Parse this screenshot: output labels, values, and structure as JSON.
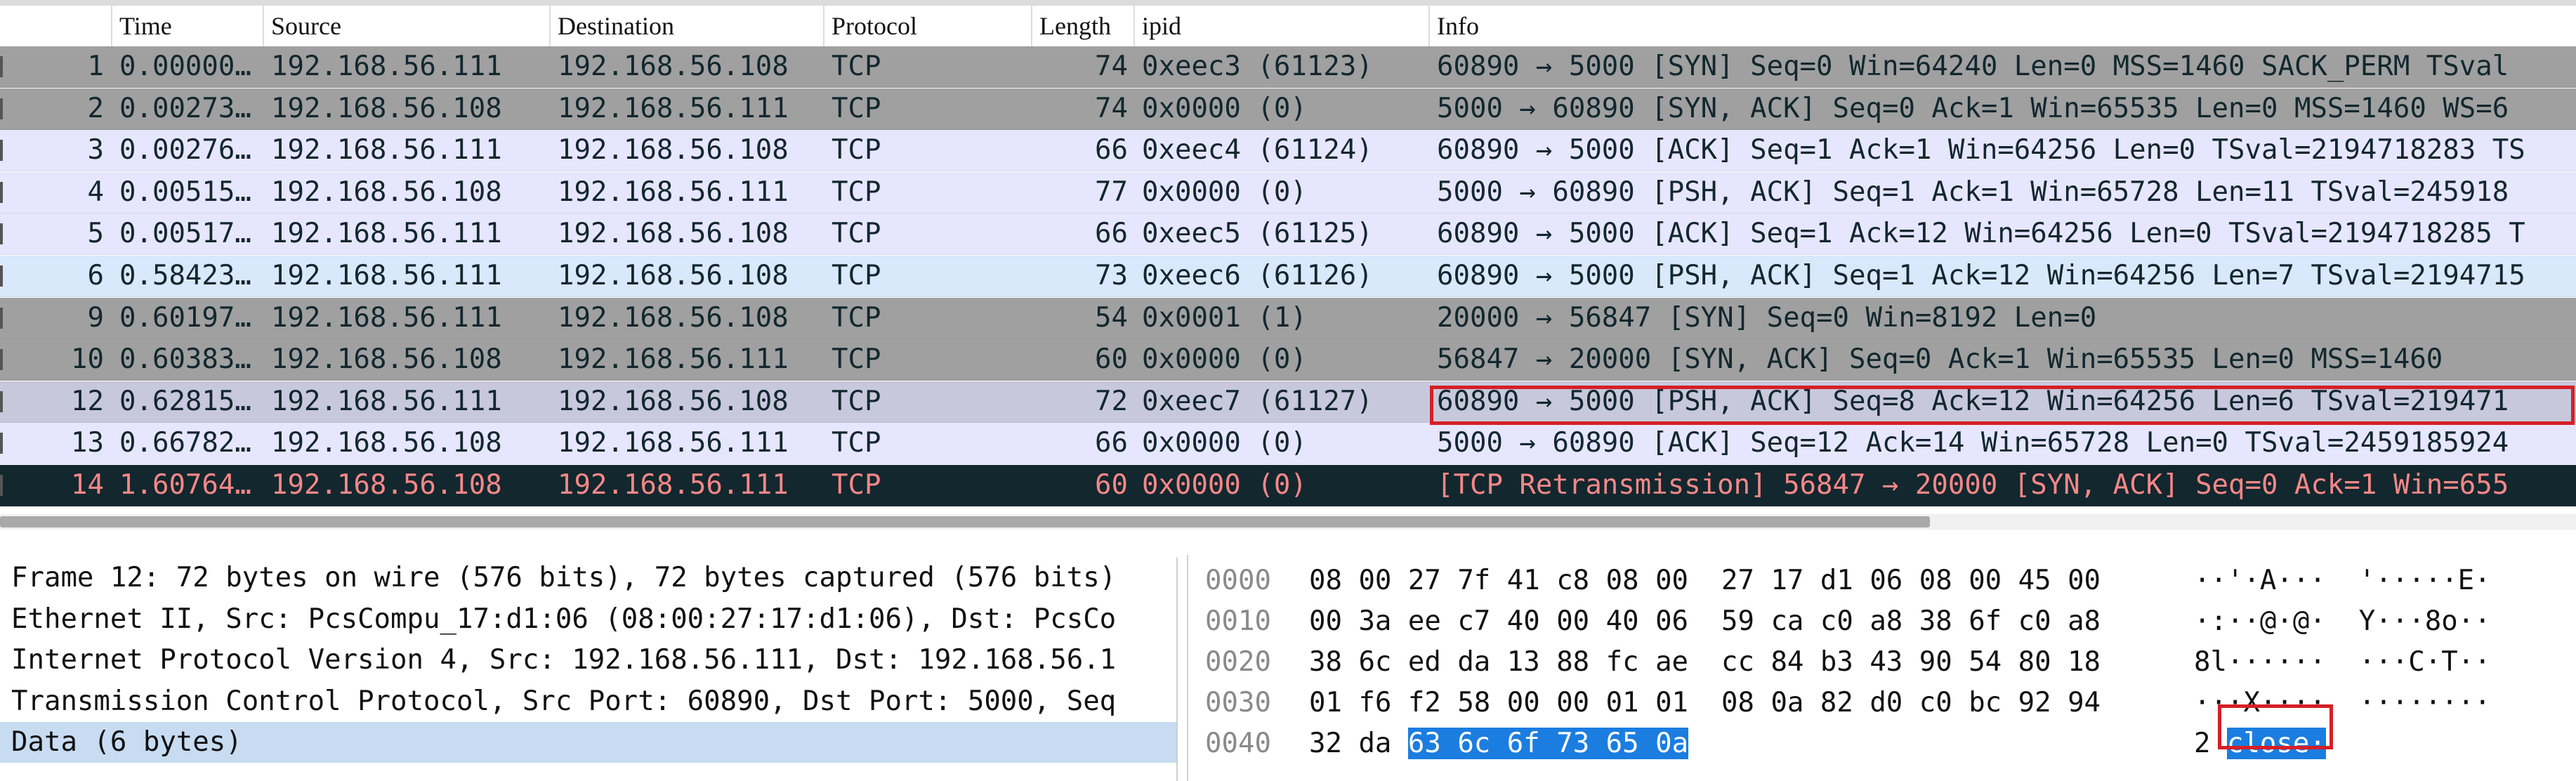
{
  "columns": {
    "no": "",
    "time": "Time",
    "source": "Source",
    "destination": "Destination",
    "protocol": "Protocol",
    "length": "Length",
    "ipid": "ipid",
    "info": "Info"
  },
  "packets": [
    {
      "no": "1",
      "time": "0.00000…",
      "source": "192.168.56.111",
      "destination": "192.168.56.108",
      "protocol": "TCP",
      "length": "74",
      "ipid": "0xeec3 (61123)",
      "info": "60890 → 5000 [SYN] Seq=0 Win=64240 Len=0 MSS=1460 SACK_PERM TSval",
      "bg": "#a0a0a0",
      "fg": "#12272e"
    },
    {
      "no": "2",
      "time": "0.00273…",
      "source": "192.168.56.108",
      "destination": "192.168.56.111",
      "protocol": "TCP",
      "length": "74",
      "ipid": "0x0000 (0)",
      "info": "5000 → 60890 [SYN, ACK] Seq=0 Ack=1 Win=65535 Len=0 MSS=1460 WS=6",
      "bg": "#a0a0a0",
      "fg": "#12272e"
    },
    {
      "no": "3",
      "time": "0.00276…",
      "source": "192.168.56.111",
      "destination": "192.168.56.108",
      "protocol": "TCP",
      "length": "66",
      "ipid": "0xeec4 (61124)",
      "info": "60890 → 5000 [ACK] Seq=1 Ack=1 Win=64256 Len=0 TSval=2194718283 TS",
      "bg": "#e7e6ff",
      "fg": "#12272e"
    },
    {
      "no": "4",
      "time": "0.00515…",
      "source": "192.168.56.108",
      "destination": "192.168.56.111",
      "protocol": "TCP",
      "length": "77",
      "ipid": "0x0000 (0)",
      "info": "5000 → 60890 [PSH, ACK] Seq=1 Ack=1 Win=65728 Len=11 TSval=245918",
      "bg": "#e7e6ff",
      "fg": "#12272e"
    },
    {
      "no": "5",
      "time": "0.00517…",
      "source": "192.168.56.111",
      "destination": "192.168.56.108",
      "protocol": "TCP",
      "length": "66",
      "ipid": "0xeec5 (61125)",
      "info": "60890 → 5000 [ACK] Seq=1 Ack=12 Win=64256 Len=0 TSval=2194718285 T",
      "bg": "#e7e6ff",
      "fg": "#12272e"
    },
    {
      "no": "6",
      "time": "0.58423…",
      "source": "192.168.56.111",
      "destination": "192.168.56.108",
      "protocol": "TCP",
      "length": "73",
      "ipid": "0xeec6 (61126)",
      "info": "60890 → 5000 [PSH, ACK] Seq=1 Ack=12 Win=64256 Len=7 TSval=2194715",
      "bg": "#dae8fc",
      "fg": "#12272e"
    },
    {
      "no": "9",
      "time": "0.60197…",
      "source": "192.168.56.111",
      "destination": "192.168.56.108",
      "protocol": "TCP",
      "length": "54",
      "ipid": "0x0001 (1)",
      "info": "20000 → 56847 [SYN] Seq=0 Win=8192 Len=0",
      "bg": "#a0a0a0",
      "fg": "#12272e"
    },
    {
      "no": "10",
      "time": "0.60383…",
      "source": "192.168.56.108",
      "destination": "192.168.56.111",
      "protocol": "TCP",
      "length": "60",
      "ipid": "0x0000 (0)",
      "info": "56847 → 20000 [SYN, ACK] Seq=0 Ack=1 Win=65535 Len=0 MSS=1460",
      "bg": "#a0a0a0",
      "fg": "#12272e"
    },
    {
      "no": "12",
      "time": "0.62815…",
      "source": "192.168.56.111",
      "destination": "192.168.56.108",
      "protocol": "TCP",
      "length": "72",
      "ipid": "0xeec7 (61127)",
      "info": "60890 → 5000 [PSH, ACK] Seq=8 Ack=12 Win=64256 Len=6 TSval=219471",
      "bg": "#c8c8dc",
      "fg": "#12272e"
    },
    {
      "no": "13",
      "time": "0.66782…",
      "source": "192.168.56.108",
      "destination": "192.168.56.111",
      "protocol": "TCP",
      "length": "66",
      "ipid": "0x0000 (0)",
      "info": "5000 → 60890 [ACK] Seq=12 Ack=14 Win=65728 Len=0 TSval=2459185924",
      "bg": "#e7e6ff",
      "fg": "#12272e"
    },
    {
      "no": "14",
      "time": "1.60764…",
      "source": "192.168.56.108",
      "destination": "192.168.56.111",
      "protocol": "TCP",
      "length": "60",
      "ipid": "0x0000 (0)",
      "info": "[TCP Retransmission] 56847 → 20000 [SYN, ACK] Seq=0 Ack=1 Win=655",
      "bg": "#12272e",
      "fg": "#f78787"
    }
  ],
  "details": [
    {
      "text": "Frame 12: 72 bytes on wire (576 bits), 72 bytes captured (576 bits)",
      "selected": false
    },
    {
      "text": "Ethernet II, Src: PcsCompu_17:d1:06 (08:00:27:17:d1:06), Dst: PcsCo",
      "selected": false
    },
    {
      "text": "Internet Protocol Version 4, Src: 192.168.56.111, Dst: 192.168.56.1",
      "selected": false
    },
    {
      "text": "Transmission Control Protocol, Src Port: 60890, Dst Port: 5000, Seq",
      "selected": false
    },
    {
      "text": "Data (6 bytes)",
      "selected": true
    }
  ],
  "hex": [
    {
      "offset": "0000",
      "bytes": "08 00 27 7f 41 c8 08 00  27 17 d1 06 08 00 45 00",
      "ascii": "··'·A···  '·····E·"
    },
    {
      "offset": "0010",
      "bytes": "00 3a ee c7 40 00 40 06  59 ca c0 a8 38 6f c0 a8",
      "ascii": "·:··@·@·  Y···8o··"
    },
    {
      "offset": "0020",
      "bytes": "38 6c ed da 13 88 fc ae  cc 84 b3 43 90 54 80 18",
      "ascii": "8l······  ···C·T··"
    },
    {
      "offset": "0030",
      "bytes": "01 f6 f2 58 00 00 01 01  08 0a 82 d0 c0 bc 92 94",
      "ascii": "···X····  ········"
    },
    {
      "offset": "0040",
      "bytes": "32 da ",
      "bytes_sel": "63 6c 6f 73 65 0a",
      "ascii": "2 ",
      "ascii_sel": "close·"
    }
  ]
}
